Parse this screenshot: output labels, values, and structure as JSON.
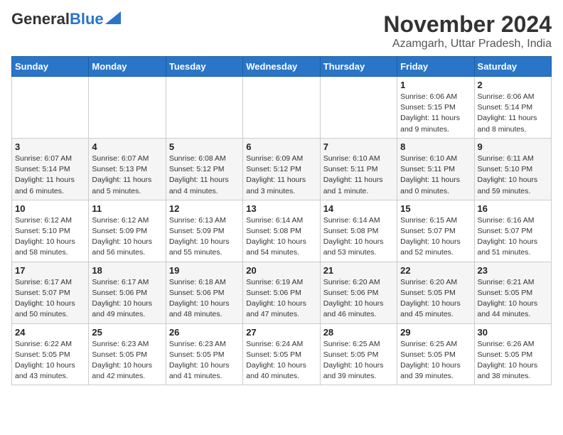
{
  "header": {
    "logo_general": "General",
    "logo_blue": "Blue",
    "title": "November 2024",
    "subtitle": "Azamgarh, Uttar Pradesh, India"
  },
  "weekdays": [
    "Sunday",
    "Monday",
    "Tuesday",
    "Wednesday",
    "Thursday",
    "Friday",
    "Saturday"
  ],
  "weeks": [
    {
      "days": [
        {
          "num": "",
          "info": ""
        },
        {
          "num": "",
          "info": ""
        },
        {
          "num": "",
          "info": ""
        },
        {
          "num": "",
          "info": ""
        },
        {
          "num": "",
          "info": ""
        },
        {
          "num": "1",
          "info": "Sunrise: 6:06 AM\nSunset: 5:15 PM\nDaylight: 11 hours and 9 minutes."
        },
        {
          "num": "2",
          "info": "Sunrise: 6:06 AM\nSunset: 5:14 PM\nDaylight: 11 hours and 8 minutes."
        }
      ]
    },
    {
      "days": [
        {
          "num": "3",
          "info": "Sunrise: 6:07 AM\nSunset: 5:14 PM\nDaylight: 11 hours and 6 minutes."
        },
        {
          "num": "4",
          "info": "Sunrise: 6:07 AM\nSunset: 5:13 PM\nDaylight: 11 hours and 5 minutes."
        },
        {
          "num": "5",
          "info": "Sunrise: 6:08 AM\nSunset: 5:12 PM\nDaylight: 11 hours and 4 minutes."
        },
        {
          "num": "6",
          "info": "Sunrise: 6:09 AM\nSunset: 5:12 PM\nDaylight: 11 hours and 3 minutes."
        },
        {
          "num": "7",
          "info": "Sunrise: 6:10 AM\nSunset: 5:11 PM\nDaylight: 11 hours and 1 minute."
        },
        {
          "num": "8",
          "info": "Sunrise: 6:10 AM\nSunset: 5:11 PM\nDaylight: 11 hours and 0 minutes."
        },
        {
          "num": "9",
          "info": "Sunrise: 6:11 AM\nSunset: 5:10 PM\nDaylight: 10 hours and 59 minutes."
        }
      ]
    },
    {
      "days": [
        {
          "num": "10",
          "info": "Sunrise: 6:12 AM\nSunset: 5:10 PM\nDaylight: 10 hours and 58 minutes."
        },
        {
          "num": "11",
          "info": "Sunrise: 6:12 AM\nSunset: 5:09 PM\nDaylight: 10 hours and 56 minutes."
        },
        {
          "num": "12",
          "info": "Sunrise: 6:13 AM\nSunset: 5:09 PM\nDaylight: 10 hours and 55 minutes."
        },
        {
          "num": "13",
          "info": "Sunrise: 6:14 AM\nSunset: 5:08 PM\nDaylight: 10 hours and 54 minutes."
        },
        {
          "num": "14",
          "info": "Sunrise: 6:14 AM\nSunset: 5:08 PM\nDaylight: 10 hours and 53 minutes."
        },
        {
          "num": "15",
          "info": "Sunrise: 6:15 AM\nSunset: 5:07 PM\nDaylight: 10 hours and 52 minutes."
        },
        {
          "num": "16",
          "info": "Sunrise: 6:16 AM\nSunset: 5:07 PM\nDaylight: 10 hours and 51 minutes."
        }
      ]
    },
    {
      "days": [
        {
          "num": "17",
          "info": "Sunrise: 6:17 AM\nSunset: 5:07 PM\nDaylight: 10 hours and 50 minutes."
        },
        {
          "num": "18",
          "info": "Sunrise: 6:17 AM\nSunset: 5:06 PM\nDaylight: 10 hours and 49 minutes."
        },
        {
          "num": "19",
          "info": "Sunrise: 6:18 AM\nSunset: 5:06 PM\nDaylight: 10 hours and 48 minutes."
        },
        {
          "num": "20",
          "info": "Sunrise: 6:19 AM\nSunset: 5:06 PM\nDaylight: 10 hours and 47 minutes."
        },
        {
          "num": "21",
          "info": "Sunrise: 6:20 AM\nSunset: 5:06 PM\nDaylight: 10 hours and 46 minutes."
        },
        {
          "num": "22",
          "info": "Sunrise: 6:20 AM\nSunset: 5:05 PM\nDaylight: 10 hours and 45 minutes."
        },
        {
          "num": "23",
          "info": "Sunrise: 6:21 AM\nSunset: 5:05 PM\nDaylight: 10 hours and 44 minutes."
        }
      ]
    },
    {
      "days": [
        {
          "num": "24",
          "info": "Sunrise: 6:22 AM\nSunset: 5:05 PM\nDaylight: 10 hours and 43 minutes."
        },
        {
          "num": "25",
          "info": "Sunrise: 6:23 AM\nSunset: 5:05 PM\nDaylight: 10 hours and 42 minutes."
        },
        {
          "num": "26",
          "info": "Sunrise: 6:23 AM\nSunset: 5:05 PM\nDaylight: 10 hours and 41 minutes."
        },
        {
          "num": "27",
          "info": "Sunrise: 6:24 AM\nSunset: 5:05 PM\nDaylight: 10 hours and 40 minutes."
        },
        {
          "num": "28",
          "info": "Sunrise: 6:25 AM\nSunset: 5:05 PM\nDaylight: 10 hours and 39 minutes."
        },
        {
          "num": "29",
          "info": "Sunrise: 6:25 AM\nSunset: 5:05 PM\nDaylight: 10 hours and 39 minutes."
        },
        {
          "num": "30",
          "info": "Sunrise: 6:26 AM\nSunset: 5:05 PM\nDaylight: 10 hours and 38 minutes."
        }
      ]
    }
  ]
}
